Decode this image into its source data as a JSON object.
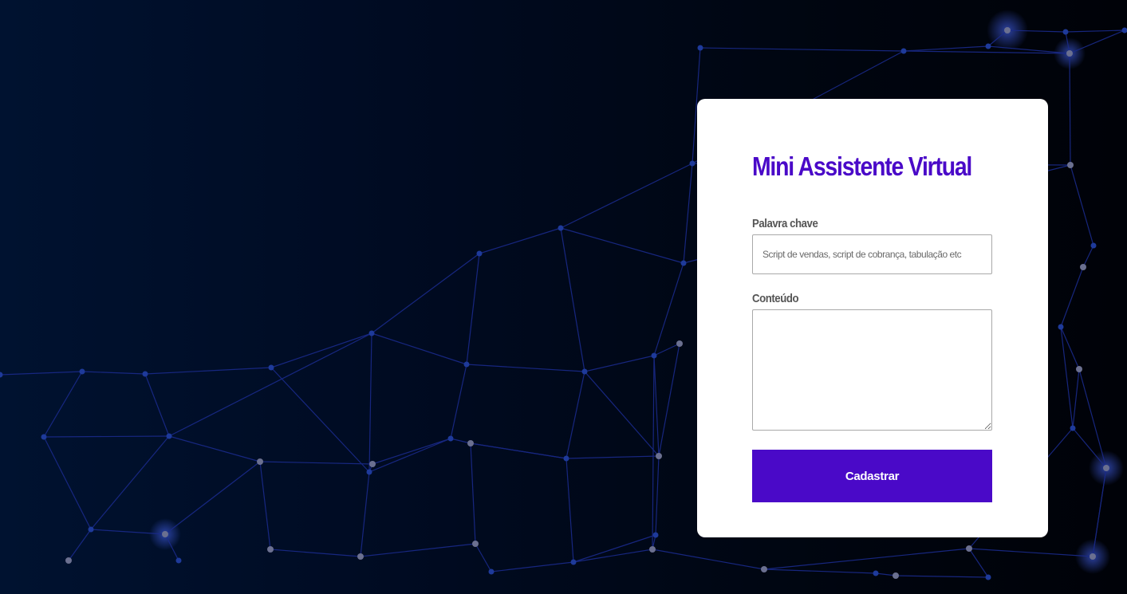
{
  "colors": {
    "accent": "#4a09c8",
    "background_dark": "#000b22",
    "network_line": "#1a2a8a",
    "network_node": "#1e3a9a",
    "network_node_light": "#6b7090",
    "card_background": "#ffffff"
  },
  "form": {
    "title": "Mini Assistente Virtual",
    "keyword": {
      "label": "Palavra chave",
      "placeholder": "Script de vendas, script de cobrança, tabulação etc",
      "value": ""
    },
    "content": {
      "label": "Conteúdo",
      "value": ""
    },
    "submit_label": "Cadastrar"
  }
}
